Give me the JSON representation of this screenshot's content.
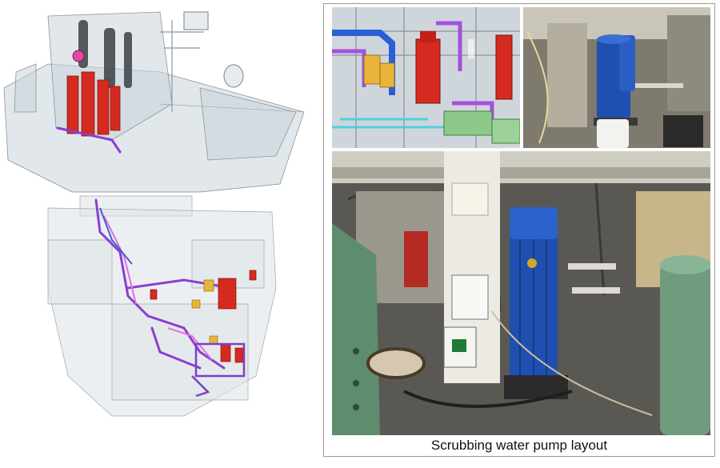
{
  "figure": {
    "caption": "Scrubbing water pump layout",
    "panels": [
      {
        "id": "ship-3d-cutaway",
        "kind": "3D model render"
      },
      {
        "id": "pump-room-3d-model",
        "kind": "3D model render"
      },
      {
        "id": "pump-photo-small",
        "kind": "photograph"
      },
      {
        "id": "pump-photo-large",
        "kind": "photograph"
      }
    ],
    "colors": {
      "pump_red": "#d42a20",
      "pump_blue": "#1f4fb0",
      "pipe_purple": "#8a3fd0",
      "hull_gray": "#c8d0d6",
      "motor_green": "#6f9c7e"
    }
  }
}
